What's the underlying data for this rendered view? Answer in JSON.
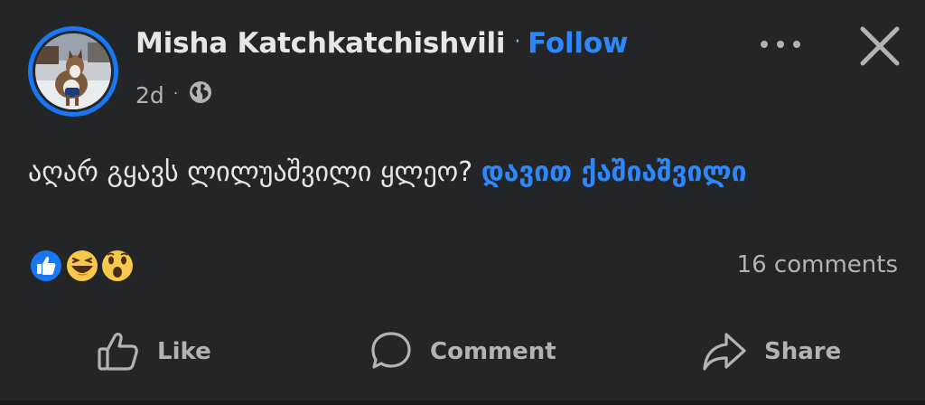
{
  "post": {
    "author_name": "Misha Katchkatchishvili",
    "separator": "·",
    "follow_label": "Follow",
    "timestamp": "2d",
    "meta_separator": "·",
    "privacy_icon": "globe-icon",
    "text_main": "აღარ გყავს ლილუაშვილი ყლეო? ",
    "mention": "დავით ქაშიაშვილი",
    "reaction_icons": [
      "like-reaction-icon",
      "haha-reaction-icon",
      "wow-reaction-icon"
    ],
    "comments_count": "16 comments"
  },
  "header_controls": {
    "more_icon": "more-options-icon",
    "close_icon": "close-icon"
  },
  "actions": {
    "like_label": "Like",
    "comment_label": "Comment",
    "share_label": "Share"
  },
  "colors": {
    "background": "#242526",
    "text": "#e4e6eb",
    "secondary_text": "#b0b3b8",
    "link_blue": "#2d88ff",
    "ring_blue": "#1877f2"
  }
}
